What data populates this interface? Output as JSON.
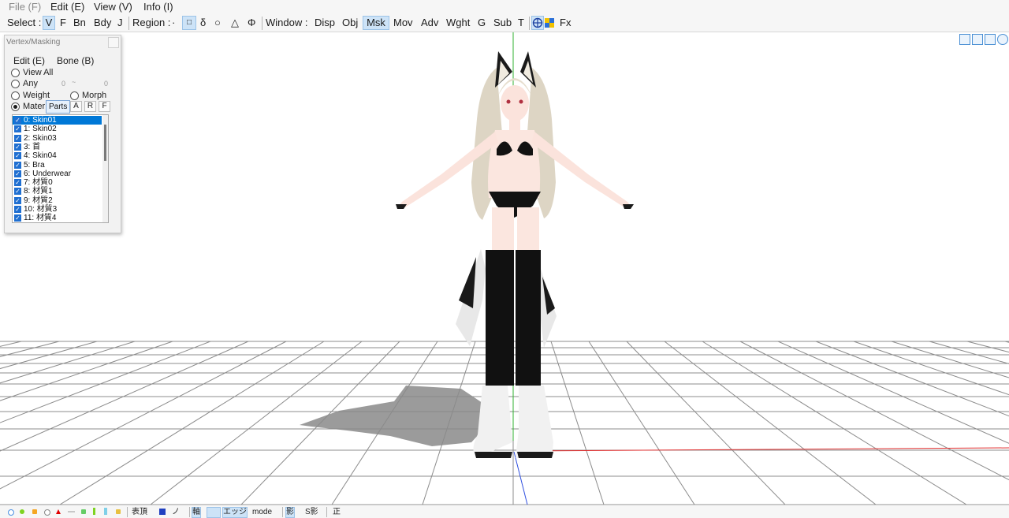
{
  "menubar": {
    "file": "File (F)",
    "edit": "Edit (E)",
    "view": "View (V)",
    "info": "Info (I)"
  },
  "toolbar": {
    "select_label": "Select :",
    "select_items": [
      "V",
      "F",
      "Bn",
      "Bdy",
      "J"
    ],
    "region_label": "Region :",
    "region_items": [
      "·",
      "□",
      "δ",
      "○",
      "△",
      "Φ"
    ],
    "window_label": "Window :",
    "window_items": [
      "Disp",
      "Obj",
      "Msk",
      "Mov",
      "Adv",
      "Wght",
      "G",
      "Sub",
      "T"
    ],
    "fx_label": "Fx",
    "active_select": "V",
    "active_window": "Msk"
  },
  "panel": {
    "title": "Vertex/Masking",
    "menu_edit": "Edit (E)",
    "menu_bone": "Bone (B)",
    "view_all": "View All",
    "any": "Any",
    "any_from": "0",
    "any_tilde": "~",
    "any_to": "0",
    "weight": "Weight",
    "morph": "Morph",
    "material": "Mater",
    "parts_tooltip": "Parts",
    "btn_a": "A",
    "btn_r": "R",
    "btn_f": "F",
    "selected_mode": "material",
    "materials": [
      "0: Skin01",
      "1: Skin02",
      "2: Skin03",
      "3: 首",
      "4: Skin04",
      "5: Bra",
      "6: Underwear",
      "7: 材質0",
      "8: 材質1",
      "9: 材質2",
      "10: 材質3",
      "11: 材質4"
    ],
    "selected_material_index": 0
  },
  "viewport": {
    "nav_icons": [
      "move-view-icon",
      "move-view-alt-icon",
      "zoom-icon",
      "rotate-view-icon"
    ]
  },
  "statusbar": {
    "labels": {
      "hyocho": "表頂",
      "no": "ノ",
      "axis": "軸",
      "edge": "エッジ",
      "mode": "mode",
      "shadow": "影",
      "s_shadow": "S影",
      "front": "正"
    },
    "colors": [
      "#4a90e2",
      "#7ed321",
      "#f5a623",
      "#9aa0a6",
      "#e00000",
      "#c8c8c8",
      "#66cc66",
      "#7fd0e8"
    ]
  },
  "theme": {
    "accent": "#0078d7",
    "grid": "#8c8c8c",
    "axis_x": "#e03030",
    "axis_y": "#30b030",
    "axis_z": "#3050e0"
  }
}
